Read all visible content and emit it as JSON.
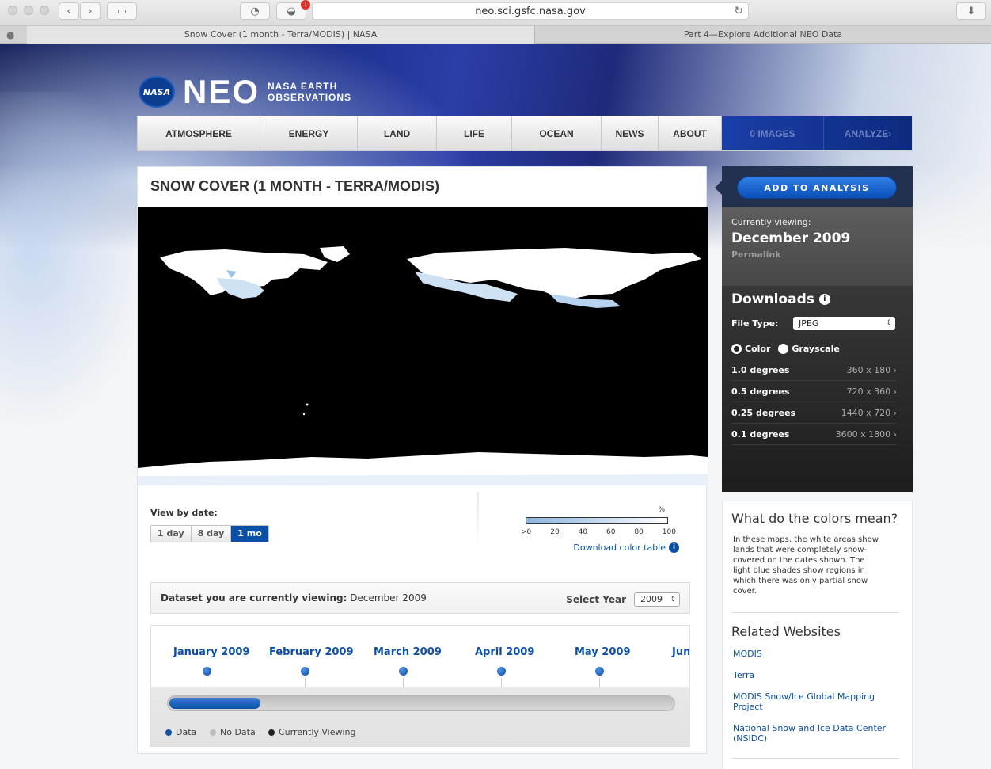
{
  "browser": {
    "url": "neo.sci.gsfc.nasa.gov",
    "notification_count": "1",
    "tabs": [
      {
        "label": "Snow Cover (1 month - Terra/MODIS) | NASA",
        "active": true
      },
      {
        "label": "Part 4—Explore Additional NEO Data",
        "active": false
      }
    ]
  },
  "header": {
    "nasa_logo_text": "NASA",
    "brand": "NEO",
    "tagline_line1": "NASA EARTH",
    "tagline_line2": "OBSERVATIONS"
  },
  "nav": {
    "items": [
      "ATMOSPHERE",
      "ENERGY",
      "LAND",
      "LIFE",
      "OCEAN",
      "NEWS",
      "ABOUT"
    ],
    "images": "0 IMAGES",
    "analyze": "ANALYZE"
  },
  "main": {
    "title": "SNOW COVER (1 MONTH - TERRA/MODIS)",
    "view_by_date_label": "View by date:",
    "date_options": [
      "1 day",
      "8 day",
      "1 mo"
    ],
    "active_date_option": "1 mo",
    "legend": {
      "unit": "%",
      "ticks": [
        ">0",
        "20",
        "40",
        "60",
        "80",
        "100"
      ],
      "download_link": "Download color table"
    },
    "dataset": {
      "prefix": "Dataset you are currently viewing:",
      "value": "December 2009",
      "select_year_label": "Select Year",
      "year": "2009"
    },
    "timeline": {
      "months": [
        "January 2009",
        "February 2009",
        "March 2009",
        "April 2009",
        "May 2009",
        "June"
      ],
      "scroll_position_fraction": 0.18,
      "key": [
        {
          "label": "Data",
          "color": "#0b4fa6"
        },
        {
          "label": "No Data",
          "color": "#bdbdbd"
        },
        {
          "label": "Currently Viewing",
          "color": "#222222"
        }
      ]
    }
  },
  "sidebar": {
    "add_button": "ADD TO ANALYSIS",
    "currently_viewing_label": "Currently viewing:",
    "currently_viewing_date": "December 2009",
    "permalink": "Permalink",
    "downloads_title": "Downloads",
    "file_type_label": "File Type:",
    "file_type_value": "JPEG",
    "radio_color": "Color",
    "radio_grayscale": "Grayscale",
    "resolutions": [
      {
        "label": "1.0 degrees",
        "size": "360 x 180"
      },
      {
        "label": "0.5 degrees",
        "size": "720 x 360"
      },
      {
        "label": "0.25 degrees",
        "size": "1440 x 720"
      },
      {
        "label": "0.1 degrees",
        "size": "3600 x 1800"
      }
    ]
  },
  "info_panel": {
    "title": "What do the colors mean?",
    "body": "In these maps, the white areas show lands that were completely snow-covered on the dates shown. The light blue shades show regions in which there was only partial snow cover.",
    "related_title": "Related Websites",
    "links": [
      "MODIS",
      "Terra",
      "MODIS Snow/Ice Global Mapping Project",
      "National Snow and Ice Data Center (NSIDC)"
    ]
  }
}
